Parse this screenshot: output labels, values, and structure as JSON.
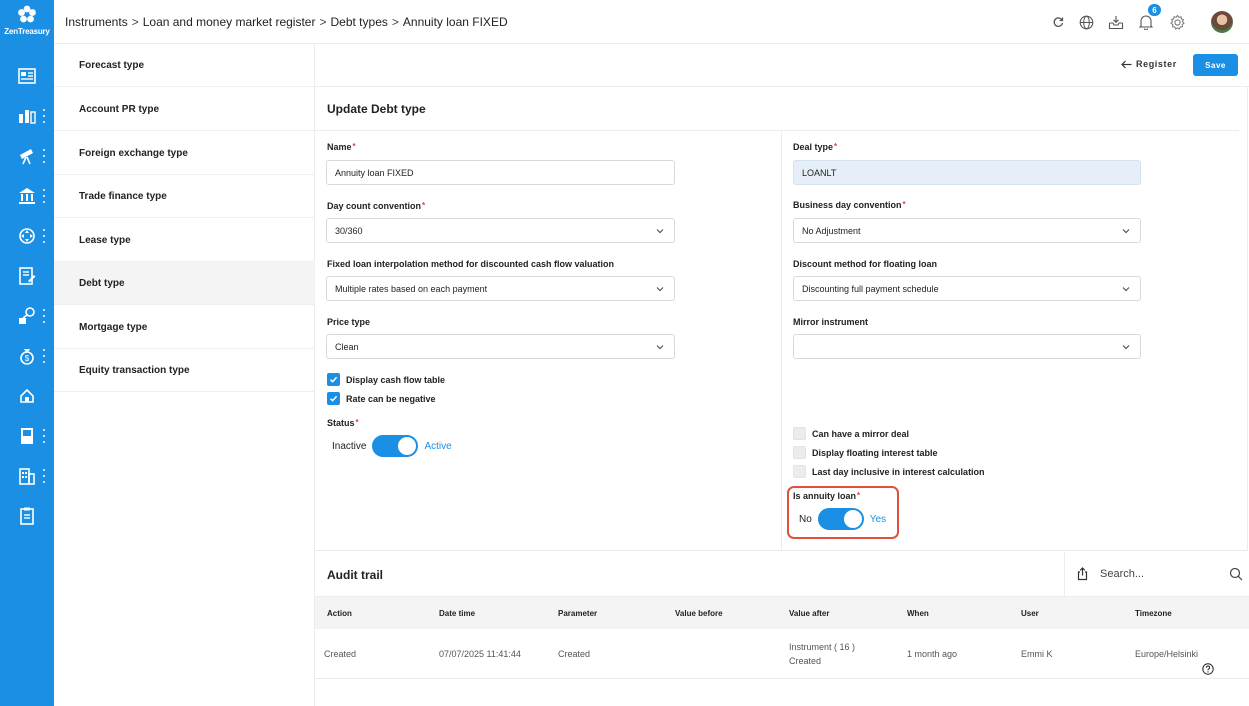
{
  "app": {
    "brand": "ZenTreasury"
  },
  "breadcrumb": [
    "Instruments",
    "Loan and money market register",
    "Debt types",
    "Annuity loan FIXED"
  ],
  "topbar": {
    "notification_count": "6"
  },
  "subnav": {
    "items": [
      {
        "label": "Forecast type"
      },
      {
        "label": "Account PR type"
      },
      {
        "label": "Foreign exchange type"
      },
      {
        "label": "Trade finance type"
      },
      {
        "label": "Lease type"
      },
      {
        "label": "Debt type"
      },
      {
        "label": "Mortgage type"
      },
      {
        "label": "Equity transaction type"
      }
    ],
    "active_index": 5
  },
  "actions": {
    "register_label": "Register",
    "save_label": "Save"
  },
  "form": {
    "title": "Update Debt type",
    "name": {
      "label": "Name",
      "value": "Annuity loan FIXED"
    },
    "day_count": {
      "label": "Day count convention",
      "value": "30/360"
    },
    "interpolation": {
      "label": "Fixed loan interpolation method for discounted cash flow valuation",
      "value": "Multiple rates based on each payment"
    },
    "price_type": {
      "label": "Price type",
      "value": "Clean"
    },
    "checks_left": [
      {
        "label": "Display cash flow table",
        "checked": true
      },
      {
        "label": "Rate can be negative",
        "checked": true
      }
    ],
    "status": {
      "label": "Status",
      "off_label": "Inactive",
      "on_label": "Active",
      "on": true
    },
    "deal_type": {
      "label": "Deal type",
      "value": "LOANLT"
    },
    "business_day": {
      "label": "Business day convention",
      "value": "No Adjustment"
    },
    "discount_method": {
      "label": "Discount method for floating loan",
      "value": "Discounting full payment schedule"
    },
    "mirror_instrument": {
      "label": "Mirror instrument",
      "value": ""
    },
    "checks_right": [
      {
        "label": "Can have a mirror deal",
        "checked": false
      },
      {
        "label": "Display floating interest table",
        "checked": false
      },
      {
        "label": "Last day inclusive in interest calculation",
        "checked": false
      }
    ],
    "annuity": {
      "label": "Is annuity loan",
      "off_label": "No",
      "on_label": "Yes",
      "on": true
    }
  },
  "audit": {
    "title": "Audit trail",
    "search_placeholder": "Search...",
    "columns": [
      "Action",
      "Date time",
      "Parameter",
      "Value before",
      "Value after",
      "When",
      "User",
      "Timezone"
    ],
    "rows": [
      {
        "action": "Created",
        "datetime": "07/07/2025 11:41:44",
        "parameter": "Created",
        "value_before": "",
        "value_after_1": "Instrument ( 16 )",
        "value_after_2": "Created",
        "when": "1 month ago",
        "user": "Emmi K",
        "timezone": "Europe/Helsinki"
      }
    ]
  },
  "colors": {
    "accent": "#1a8fe3",
    "highlight": "#e0503a"
  }
}
